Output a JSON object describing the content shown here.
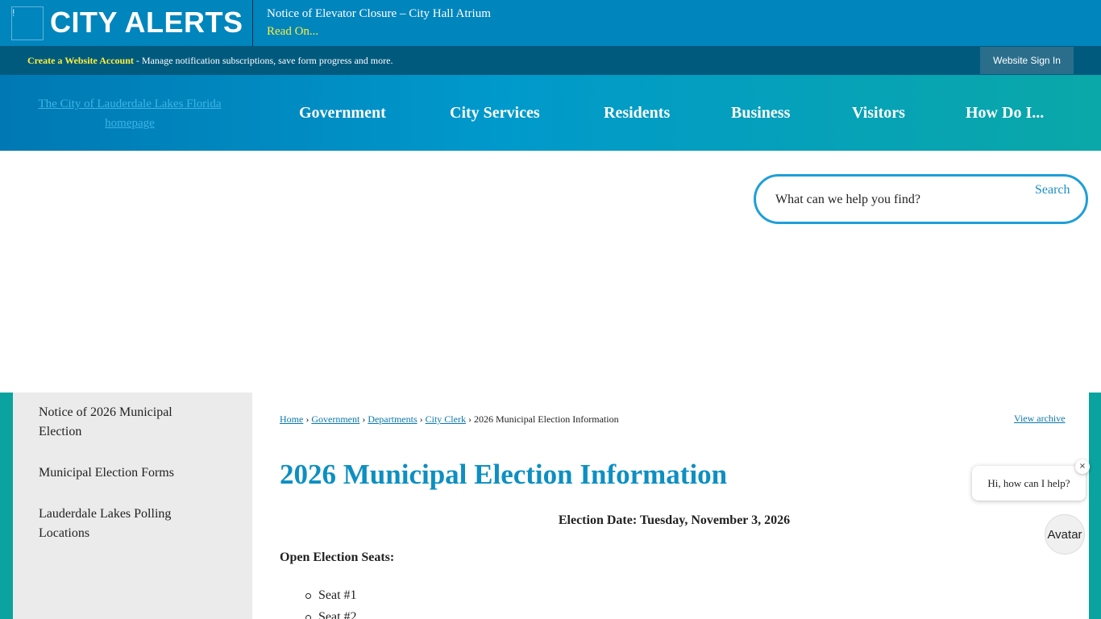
{
  "alert": {
    "icon": "alert-image-icon",
    "title": "CITY ALERTS",
    "message": "Notice of Elevator Closure – City Hall Atrium",
    "read_on": "Read On..."
  },
  "account": {
    "create_link": "Create a Website Account",
    "description": " - Manage notification subscriptions, save form progress and more.",
    "sign_in": "Website Sign In"
  },
  "header": {
    "logo_alt": "The City of Lauderdale Lakes Florida homepage",
    "nav": [
      "Government",
      "City Services",
      "Residents",
      "Business",
      "Visitors",
      "How Do I..."
    ]
  },
  "search": {
    "placeholder": "What can we help you find?",
    "button": "Search"
  },
  "sidebar": {
    "items": [
      "Notice of 2026 Municipal Election",
      "Municipal Election Forms",
      "Lauderdale Lakes Polling Locations"
    ]
  },
  "breadcrumb": {
    "items": [
      "Home",
      "Government",
      "Departments",
      "City Clerk"
    ],
    "current": "2026 Municipal Election Information",
    "separator": "›",
    "view_archive": "View archive"
  },
  "main": {
    "title": "2026 Municipal Election Information",
    "election_date": "Election Date: Tuesday, November 3, 2026",
    "open_seats_label": "Open Election Seats:",
    "seats": [
      "Seat #1",
      "Seat #2"
    ]
  },
  "chat": {
    "greeting": "Hi, how can I help?",
    "close": "×",
    "avatar": "Avatar"
  },
  "colors": {
    "alert_bg": "#0085bd",
    "account_bg": "#005a7e",
    "title_blue": "#0d8fc2",
    "teal_accent": "#0aa39f",
    "alert_link": "#ffef3c"
  }
}
